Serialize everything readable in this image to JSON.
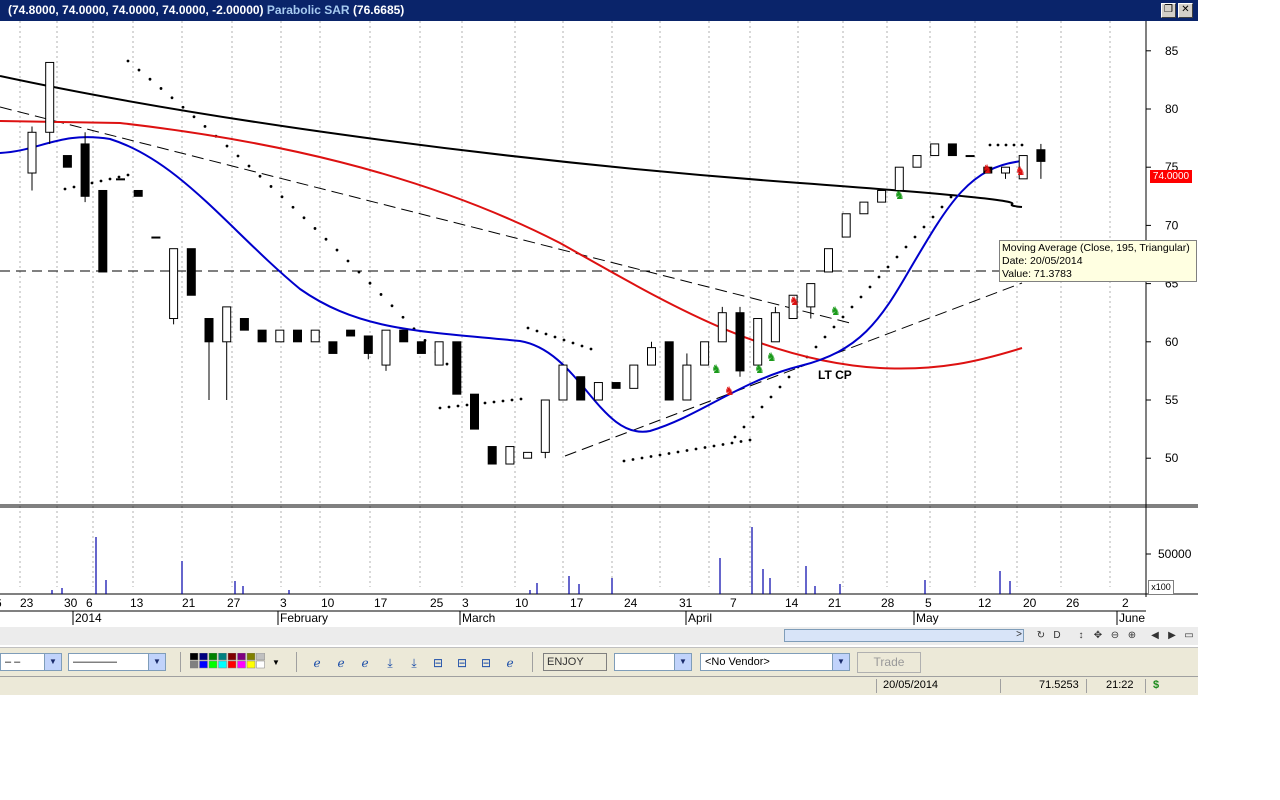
{
  "titlebar": {
    "ohlc_text": "(74.8000, 74.0000, 74.0000, 74.0000, -2.00000)",
    "sar_label": "Parabolic SAR",
    "sar_value": "(76.6685)",
    "restore_icon": "restore-icon",
    "close_icon": "close-icon",
    "bg": "#0a246a"
  },
  "chart_data": {
    "type": "candlestick",
    "y_ticks": [
      85,
      80,
      75,
      70,
      65,
      60,
      55,
      50
    ],
    "volume_ticks": [
      "50000"
    ],
    "volume_multiplier": "x100",
    "x_tick_labels": [
      "6",
      "23",
      "30",
      "6",
      "13",
      "21",
      "27",
      "3",
      "10",
      "17",
      "25",
      "3",
      "10",
      "17",
      "24",
      "31",
      "7",
      "14",
      "21",
      "28",
      "5",
      "12",
      "20",
      "26",
      "2"
    ],
    "month_labels": [
      "2014",
      "February",
      "March",
      "April",
      "May",
      "June"
    ],
    "last_price_badge": "74.0000",
    "annotation": "LT CP",
    "tooltip": {
      "line1": "Moving Average (Close, 195, Triangular)",
      "line2": "Date: 20/05/2014",
      "line3": "Value: 71.3783"
    },
    "series_colors": {
      "ma_fast": "#0000cc",
      "ma_mid": "#dd1111",
      "ma_long": "#000000",
      "sar": "#000000",
      "volume": "#0000aa"
    },
    "candles": [
      {
        "o": 74.5,
        "h": 78.5,
        "l": 73,
        "c": 78
      },
      {
        "o": 78,
        "h": 84,
        "l": 77,
        "c": 84
      },
      {
        "o": 76,
        "h": 76,
        "l": 75,
        "c": 75
      },
      {
        "o": 77,
        "h": 78,
        "l": 72,
        "c": 72.5
      },
      {
        "o": 73,
        "h": 73,
        "l": 66,
        "c": 66
      },
      {
        "o": 74,
        "h": 74,
        "l": 74,
        "c": 74
      },
      {
        "o": 73,
        "h": 73,
        "l": 72.5,
        "c": 72.5
      },
      {
        "o": 69,
        "h": 69,
        "l": 69,
        "c": 69
      },
      {
        "o": 62,
        "h": 68,
        "l": 61.5,
        "c": 68
      },
      {
        "o": 68,
        "h": 68,
        "l": 64,
        "c": 64
      },
      {
        "o": 62,
        "h": 62,
        "l": 55,
        "c": 60
      },
      {
        "o": 60,
        "h": 63,
        "l": 55,
        "c": 63
      },
      {
        "o": 62,
        "h": 62,
        "l": 61,
        "c": 61
      },
      {
        "o": 61,
        "h": 61,
        "l": 60,
        "c": 60
      },
      {
        "o": 60,
        "h": 61,
        "l": 60,
        "c": 61
      },
      {
        "o": 61,
        "h": 61,
        "l": 60,
        "c": 60
      },
      {
        "o": 60,
        "h": 61,
        "l": 60,
        "c": 61
      },
      {
        "o": 60,
        "h": 60,
        "l": 59,
        "c": 59
      },
      {
        "o": 61,
        "h": 61,
        "l": 60.5,
        "c": 60.5
      },
      {
        "o": 60.5,
        "h": 60.5,
        "l": 58.5,
        "c": 59
      },
      {
        "o": 58,
        "h": 61,
        "l": 57.5,
        "c": 61
      },
      {
        "o": 61,
        "h": 61,
        "l": 60,
        "c": 60
      },
      {
        "o": 60,
        "h": 60,
        "l": 59,
        "c": 59
      },
      {
        "o": 58,
        "h": 60,
        "l": 58,
        "c": 60
      },
      {
        "o": 60,
        "h": 60,
        "l": 55.5,
        "c": 55.5
      },
      {
        "o": 55.5,
        "h": 55.5,
        "l": 52.5,
        "c": 52.5
      },
      {
        "o": 51,
        "h": 51,
        "l": 49.5,
        "c": 49.5
      },
      {
        "o": 49.5,
        "h": 51,
        "l": 49.5,
        "c": 51
      },
      {
        "o": 50,
        "h": 50.5,
        "l": 50,
        "c": 50.5
      },
      {
        "o": 50.5,
        "h": 55,
        "l": 50,
        "c": 55
      },
      {
        "o": 55,
        "h": 58,
        "l": 55,
        "c": 58
      },
      {
        "o": 57,
        "h": 57,
        "l": 55,
        "c": 55
      },
      {
        "o": 55,
        "h": 56.5,
        "l": 55,
        "c": 56.5
      },
      {
        "o": 56.5,
        "h": 56.5,
        "l": 56,
        "c": 56
      },
      {
        "o": 56,
        "h": 58,
        "l": 56,
        "c": 58
      },
      {
        "o": 58,
        "h": 60,
        "l": 58,
        "c": 59.5
      },
      {
        "o": 60,
        "h": 60,
        "l": 55,
        "c": 55
      },
      {
        "o": 55,
        "h": 59,
        "l": 55,
        "c": 58
      },
      {
        "o": 58,
        "h": 60,
        "l": 58,
        "c": 60
      },
      {
        "o": 60,
        "h": 63,
        "l": 60,
        "c": 62.5
      },
      {
        "o": 62.5,
        "h": 63,
        "l": 57,
        "c": 57.5
      },
      {
        "o": 58,
        "h": 62,
        "l": 58,
        "c": 62
      },
      {
        "o": 60,
        "h": 63,
        "l": 60,
        "c": 62.5
      },
      {
        "o": 62,
        "h": 64,
        "l": 62,
        "c": 64
      },
      {
        "o": 63,
        "h": 65,
        "l": 62,
        "c": 65
      },
      {
        "o": 66,
        "h": 68,
        "l": 66,
        "c": 68
      },
      {
        "o": 69,
        "h": 71,
        "l": 69,
        "c": 71
      },
      {
        "o": 71,
        "h": 72,
        "l": 71,
        "c": 72
      },
      {
        "o": 72,
        "h": 73,
        "l": 72,
        "c": 73
      },
      {
        "o": 73,
        "h": 75,
        "l": 73,
        "c": 75
      },
      {
        "o": 75,
        "h": 76,
        "l": 75,
        "c": 76
      },
      {
        "o": 76,
        "h": 77,
        "l": 76,
        "c": 77
      },
      {
        "o": 77,
        "h": 77,
        "l": 76,
        "c": 76
      },
      {
        "o": 76,
        "h": 76,
        "l": 76,
        "c": 76
      },
      {
        "o": 75,
        "h": 75,
        "l": 74.5,
        "c": 74.5
      },
      {
        "o": 74.5,
        "h": 75,
        "l": 74,
        "c": 75
      },
      {
        "o": 74,
        "h": 76,
        "l": 74,
        "c": 76
      },
      {
        "o": 76.5,
        "h": 77,
        "l": 74,
        "c": 75.5
      }
    ]
  },
  "toolbar": {
    "line_style_1": "– –",
    "line_style_2": "————",
    "symbol": "ENJOY",
    "interval": "",
    "vendor": "<No Vendor>",
    "trade": "Trade",
    "icons": [
      "color-palette-icon",
      "ie-icon",
      "ie-icon",
      "ie-icon",
      "download-icon",
      "download-icon",
      "layout-icon",
      "layout-icon",
      "layout-icon",
      "ie-icon"
    ]
  },
  "nav": {
    "icons": [
      "refresh-icon",
      "d-icon",
      "move-vertical-icon",
      "move-icon",
      "zoom-out-icon",
      "zoom-in-icon",
      "prev-icon",
      "next-icon",
      "window-icon"
    ],
    "d_label": "D"
  },
  "status": {
    "date": "20/05/2014",
    "value": "71.5253",
    "time": "21:22",
    "currency": "$"
  }
}
